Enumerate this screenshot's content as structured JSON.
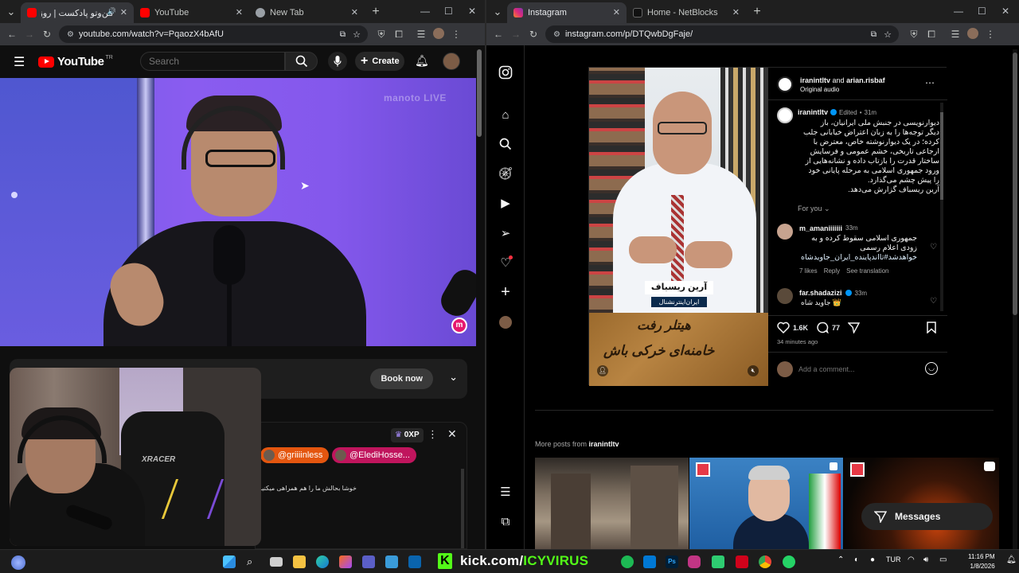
{
  "left_window": {
    "tabs": [
      {
        "title": "من‌وتو پادکست | روز دوار",
        "active": true,
        "favicon_color": "#ff0000"
      },
      {
        "title": "YouTube",
        "active": false,
        "favicon_color": "#ff0000"
      },
      {
        "title": "New Tab",
        "active": false,
        "favicon_color": "#9aa0a6"
      }
    ],
    "url": "youtube.com/watch?v=PqaozX4bAfU"
  },
  "youtube": {
    "logo_text": "YouTube",
    "logo_superscript": "TR",
    "search_placeholder": "Search",
    "create_label": "Create",
    "watermark": "manoto LIVE",
    "book_now_label": "Book now",
    "chat_xp": "0XP",
    "chat_chips": [
      "@griiiinless",
      "@ElediHosse..."
    ],
    "chat_message": "خوشا بحالش ما را هم همراهی میکنید"
  },
  "right_window": {
    "tabs": [
      {
        "title": "Instagram",
        "active": true,
        "favicon_color": "#e1306c"
      },
      {
        "title": "Home - NetBlocks",
        "active": false,
        "favicon_color": "#111111"
      }
    ],
    "url": "instagram.com/p/DTQwbDgFaje/"
  },
  "instagram": {
    "post_header": {
      "user1": "iranintltv",
      "and_text": "and",
      "user2": "arian.risbaf",
      "audio": "Original audio"
    },
    "caption": {
      "user": "iranintltv",
      "edited": "Edited",
      "dot": "•",
      "time": "31m",
      "lines": [
        "دیوارنویسی در جنبش ملی ایرانیان، باز",
        "دیگر توجه‌ها را به زبان اعتراض خیابانی جلب",
        "کرده؛ در یک دیوارنوشته خاص، معترض با",
        "ارجاعی تاریخی، خشم عمومی و فرسایش",
        "ساختار قدرت را بازتاب داده و نشانه‌هایی از",
        "ورود جمهوری اسلامی به مرحله پایانی خود",
        "را پیش چشم می‌گذارد.",
        "آرین ریسباف گزارش می‌دهد."
      ]
    },
    "for_you": "For you",
    "comments": [
      {
        "user": "m_amaniiiiiii",
        "time": "33m",
        "lines": [
          "جمهوری اسلامی سقوط کرده و به",
          "زودی اعلام رسمی",
          "خواهدشد#تااندپاینده_ایران_جاویدشاه"
        ],
        "likes": "7 likes",
        "reply": "Reply",
        "translate": "See translation"
      },
      {
        "user": "far.shadazizi",
        "time": "33m",
        "lines": [
          "جاوید شاه 👑"
        ]
      }
    ],
    "likes_count": "1.6K",
    "comments_count": "77",
    "posted_ago": "34 minutes ago",
    "add_comment_placeholder": "Add a comment...",
    "overlay_name": "آرین ریسباف",
    "overlay_channel": "ایران‌اینترنشنال",
    "wall_text_line1": "هیتلر رفت",
    "wall_text_line2": "خامنه‌ای خرکی باش",
    "more_posts_prefix": "More posts from",
    "more_posts_user": "iranintltv",
    "messages_label": "Messages"
  },
  "taskbar": {
    "kick_text_white": "kick.com/",
    "kick_text_green": "ICYVIRUS",
    "lang": "TUR",
    "time": "11:16 PM",
    "date": "1/8/2026"
  }
}
